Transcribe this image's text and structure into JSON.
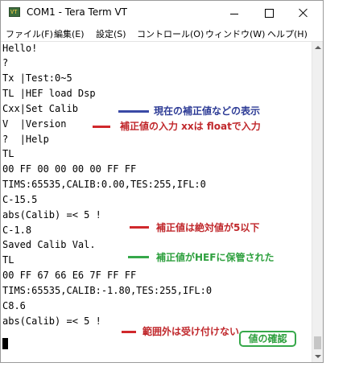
{
  "window": {
    "title": "COM1 - Tera Term VT",
    "icon": "tera-term-app-icon",
    "icon_text": "VT"
  },
  "menu": {
    "items": [
      "ファイル(F)",
      "編集(E)",
      "設定(S)",
      "コントロール(O)",
      "ウィンドウ(W)",
      "ヘルプ(H)"
    ]
  },
  "terminal": {
    "lines": [
      "Hello!",
      "?",
      "Tx |Test:0~5",
      "TL |HEF load Dsp",
      "Cxx|Set Calib",
      "V  |Version",
      "?  |Help",
      "TL",
      "00 FF 00 00 00 00 FF FF",
      "TIMS:65535,CALIB:0.00,TES:255,IFL:0",
      "C-15.5",
      "abs(Calib) =< 5 !",
      "C-1.8",
      "Saved Calib Val.",
      "TL",
      "00 FF 67 66 E6 7F FF FF",
      "TIMS:65535,CALIB:-1.80,TES:255,IFL:0",
      "C8.6",
      "abs(Calib) =< 5 !"
    ]
  },
  "annotations": {
    "hef_display": "現在の補正値などの表示",
    "calib_input": "補正値の入力  xxは floatで入力",
    "abs_limit": "補正値は絶対値が5以下",
    "saved": "補正値がHEFに保管された",
    "confirm": "値の確認",
    "out_of_range": "範囲外は受け付けない"
  },
  "colors": {
    "annotation_red": "#c0282c",
    "annotation_blue": "#2e3c96",
    "annotation_green": "#2ea03e"
  }
}
